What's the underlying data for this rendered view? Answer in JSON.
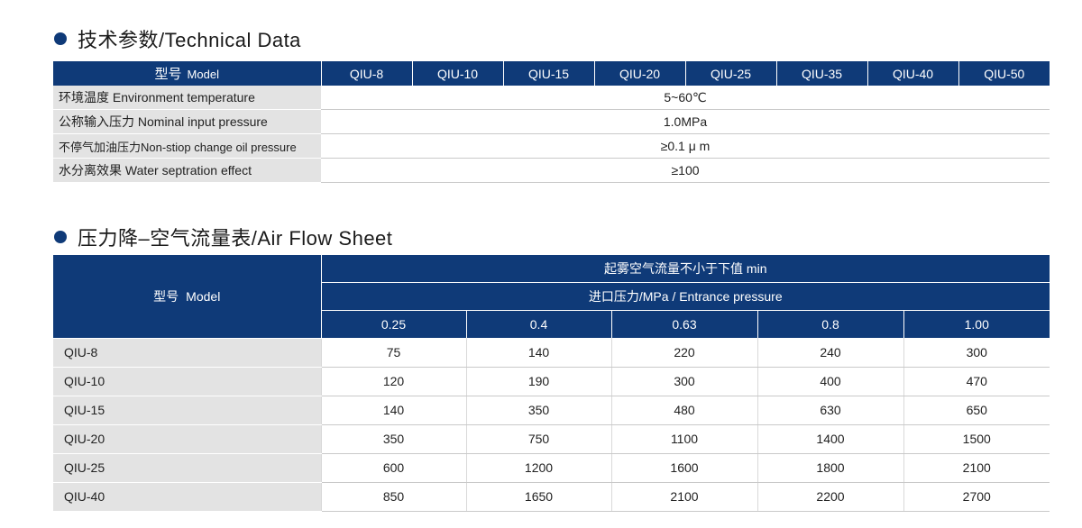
{
  "technical": {
    "title": "技术参数/Technical Data",
    "header": {
      "model_cn": "型号",
      "model_en": "Model",
      "models": [
        "QIU-8",
        "QIU-10",
        "QIU-15",
        "QIU-20",
        "QIU-25",
        "QIU-35",
        "QIU-40",
        "QIU-50"
      ]
    },
    "rows": [
      {
        "label": "环境温度  Environment temperature",
        "value": "5~60℃"
      },
      {
        "label": "公称输入压力  Nominal input pressure",
        "value": "1.0MPa"
      },
      {
        "label": "不停气加油压力Non-stiop change oil pressure",
        "value": "≥0.1 μ m"
      },
      {
        "label": "水分离效果 Water septration effect",
        "value": "≥100"
      }
    ]
  },
  "airflow": {
    "title": "压力降–空气流量表/Air Flow Sheet",
    "model_cn": "型号",
    "model_en": "Model",
    "flow_header": "起雾空气流量不小于下值 min",
    "pressure_header": "进口压力/MPa / Entrance pressure",
    "pressures": [
      "0.25",
      "0.4",
      "0.63",
      "0.8",
      "1.00"
    ],
    "rows": [
      {
        "model": "QIU-8",
        "values": [
          "75",
          "140",
          "220",
          "240",
          "300"
        ]
      },
      {
        "model": "QIU-10",
        "values": [
          "120",
          "190",
          "300",
          "400",
          "470"
        ]
      },
      {
        "model": "QIU-15",
        "values": [
          "140",
          "350",
          "480",
          "630",
          "650"
        ]
      },
      {
        "model": "QIU-20",
        "values": [
          "350",
          "750",
          "1100",
          "1400",
          "1500"
        ]
      },
      {
        "model": "QIU-25",
        "values": [
          "600",
          "1200",
          "1600",
          "1800",
          "2100"
        ]
      },
      {
        "model": "QIU-40",
        "values": [
          "850",
          "1650",
          "2100",
          "2200",
          "2700"
        ]
      }
    ]
  }
}
